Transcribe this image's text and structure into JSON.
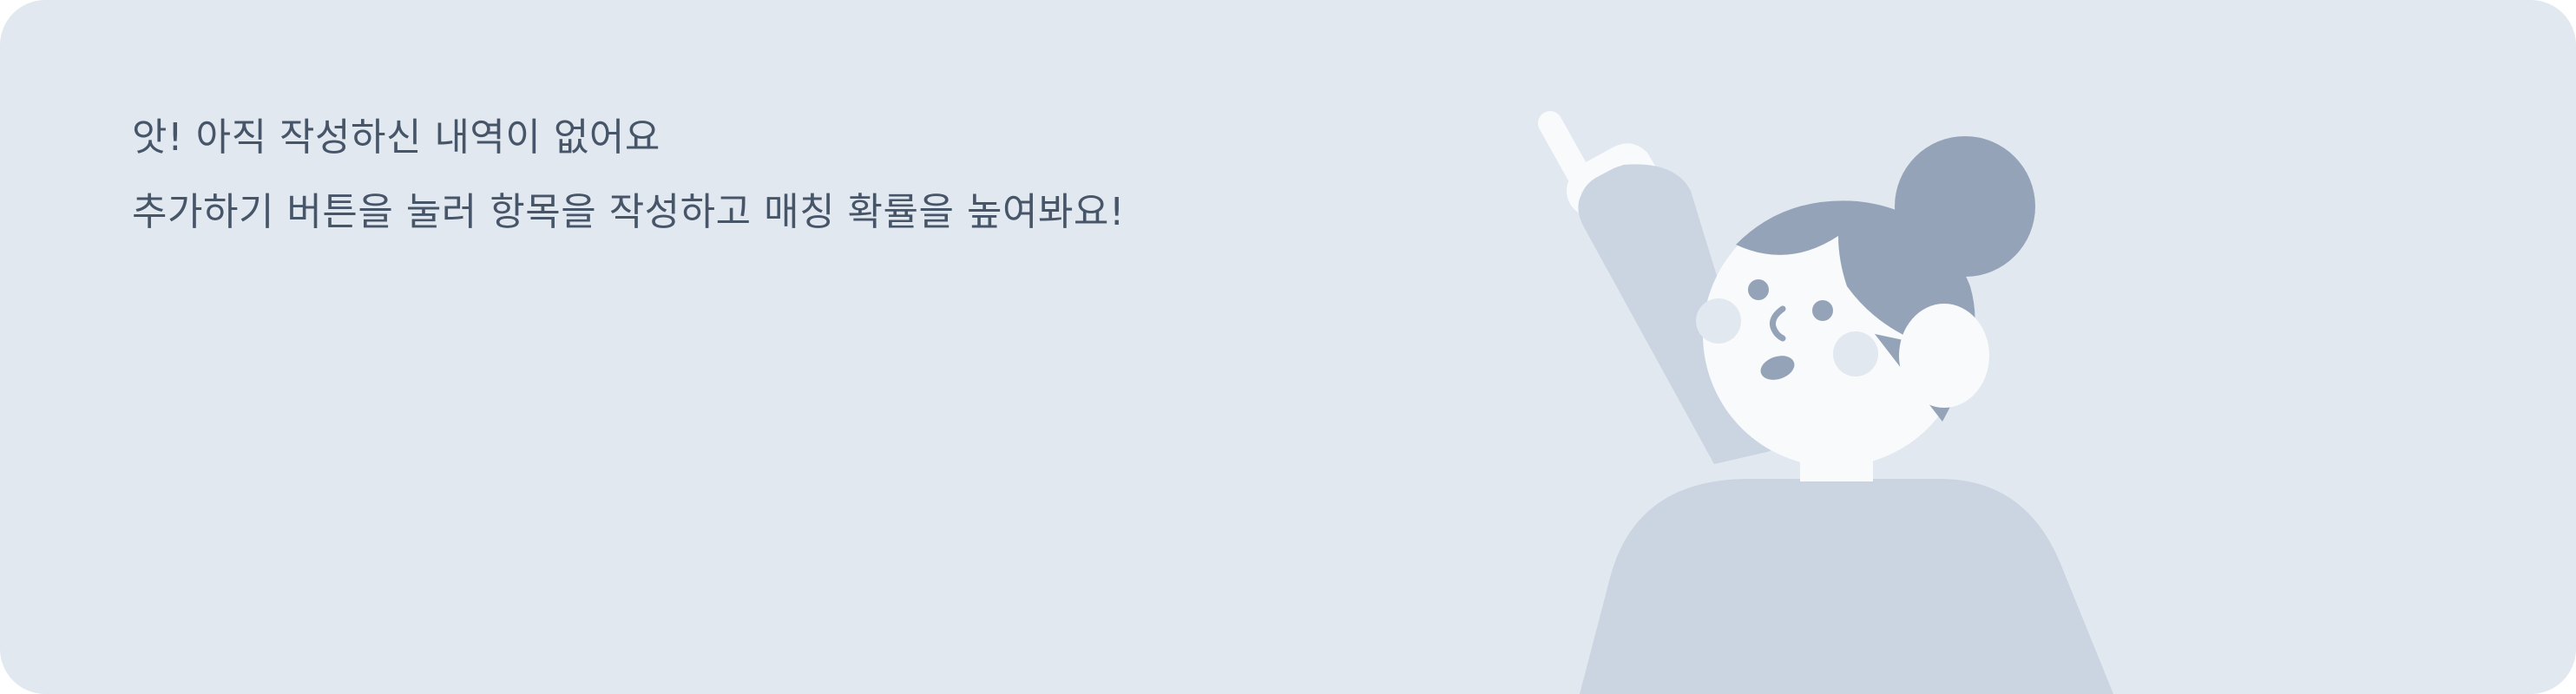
{
  "empty_state": {
    "title": "앗! 아직 작성하신 내역이 없어요",
    "description": "추가하기 버튼을 눌러 항목을 작성하고 매칭 확률을 높여봐요!"
  },
  "illustration": {
    "icon": "waving-person-illustration",
    "colors": {
      "card_background": "#e2e8f0",
      "hair": "#94a3b8",
      "skin": "#f8fafc",
      "body": "#cbd5e1",
      "cheek": "#e2e8f0",
      "text": "#475569"
    }
  }
}
